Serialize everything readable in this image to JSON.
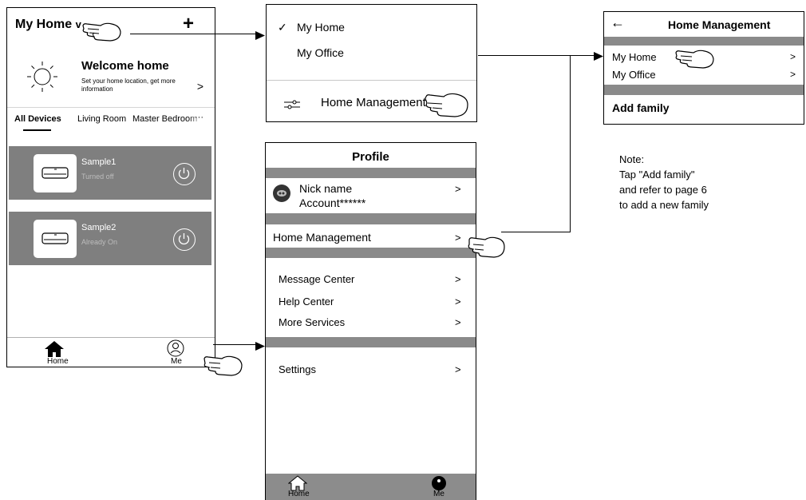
{
  "home_screen": {
    "title": "My Home",
    "title_caret": "v",
    "add_label": "+",
    "welcome_title": "Welcome home",
    "welcome_subtitle": "Set your home location, get more information",
    "welcome_chevron": ">",
    "tabs": [
      "All Devices",
      "Living Room",
      "Master Bedroom"
    ],
    "tabs_more": "···",
    "devices": [
      {
        "name": "Sample1",
        "status": "Turned off"
      },
      {
        "name": "Sample2",
        "status": "Already On"
      }
    ],
    "nav": {
      "home": "Home",
      "me": "Me"
    }
  },
  "home_dropdown": {
    "check_mark": "✓",
    "items": [
      "My Home",
      "My  Office"
    ],
    "management_label": "Home Management"
  },
  "home_management": {
    "back_icon": "←",
    "title": "Home Management",
    "homes": [
      {
        "label": "My Home",
        "chevron": ">"
      },
      {
        "label": "My  Office",
        "chevron": ">"
      }
    ],
    "add_family": "Add family"
  },
  "note": {
    "lines": [
      "Note:",
      "Tap \"Add family\"",
      "and refer to page 6",
      "to add a new family"
    ]
  },
  "profile": {
    "title": "Profile",
    "nick_name": "Nick name",
    "account": "Account******",
    "home_management": "Home Management",
    "menu": [
      "Message Center",
      "Help Center",
      "More Services"
    ],
    "settings": "Settings",
    "chevron": ">",
    "nav": {
      "home": "Home",
      "me": "Me"
    }
  },
  "colors": {
    "band_gray": "#8a8a8a",
    "card_gray": "#7f7f7f",
    "line": "#000000"
  },
  "icons": [
    "sun-icon",
    "air-conditioner-icon",
    "power-icon",
    "home-icon",
    "person-icon",
    "filter-icon",
    "hand-pointer-icon",
    "avatar-icon"
  ]
}
